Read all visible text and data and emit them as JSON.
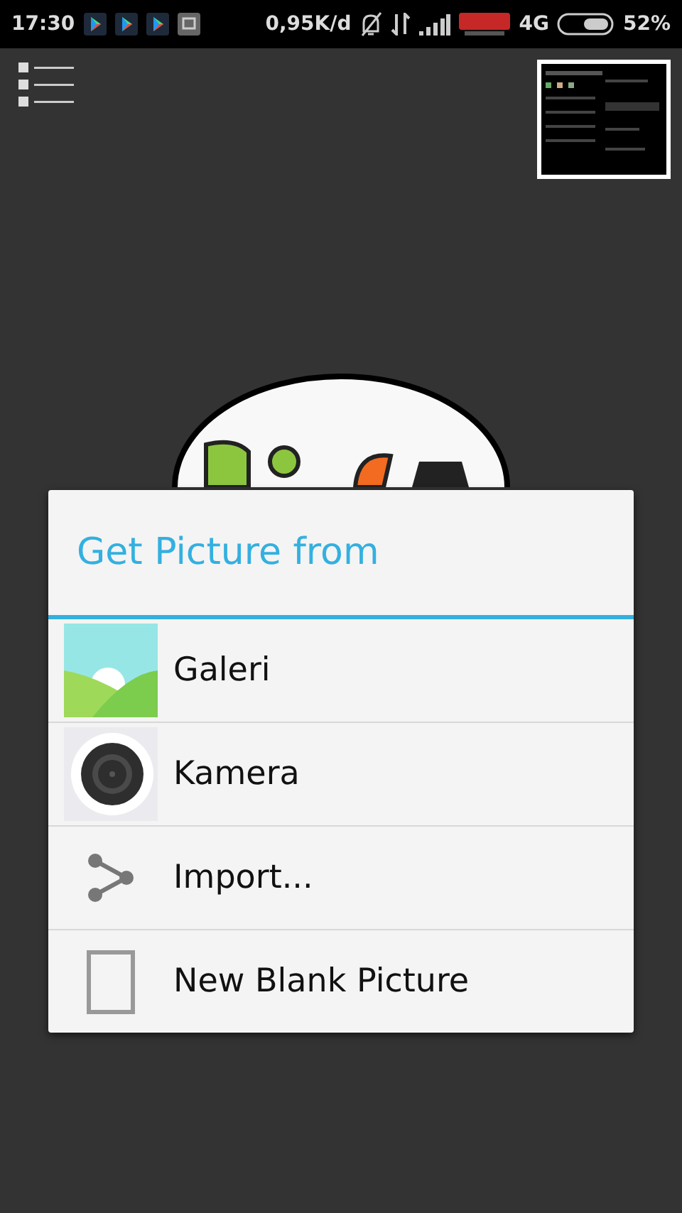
{
  "status_bar": {
    "time": "17:30",
    "speed": "0,95K/d",
    "network": "4G",
    "battery": "52%"
  },
  "dialog": {
    "title": "Get Picture from",
    "items": [
      {
        "kind": "gallery",
        "label": "Galeri"
      },
      {
        "kind": "camera",
        "label": "Kamera"
      },
      {
        "kind": "share",
        "label": "Import..."
      },
      {
        "kind": "blank",
        "label": "New Blank Picture"
      }
    ]
  }
}
